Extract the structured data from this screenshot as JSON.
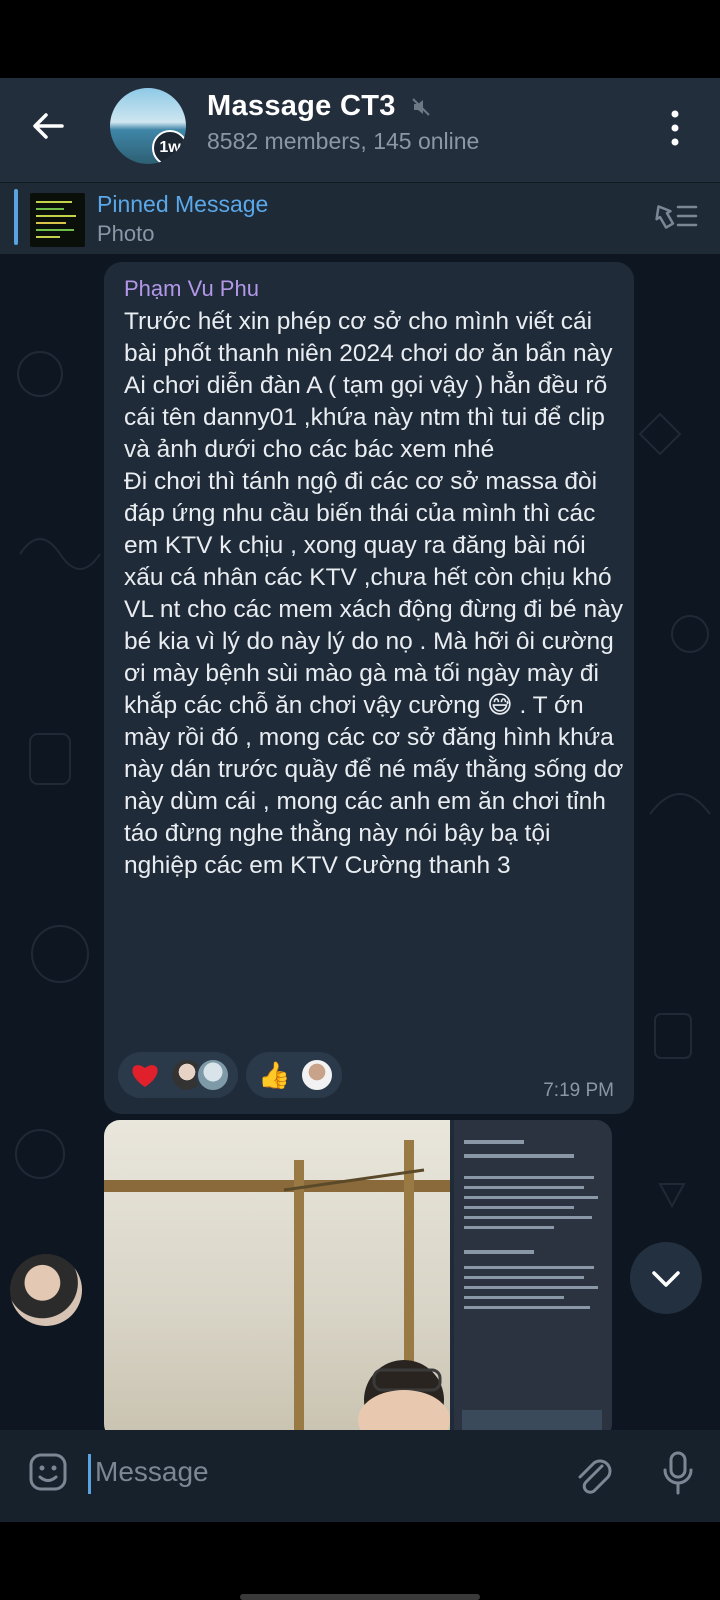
{
  "header": {
    "title": "Massage CT3",
    "subtitle": "8582 members, 145 online",
    "avatar_badge": "1w"
  },
  "pinned": {
    "title": "Pinned Message",
    "subtitle": "Photo"
  },
  "message": {
    "sender": "Phạm Vu Phu",
    "text": "Trước hết xin phép cơ sở cho mình viết cái bài phốt thanh niên 2024 chơi dơ ăn bẩn này\nAi chơi diễn đàn A ( tạm gọi vậy ) hẳn đều rõ cái tên danny01 ,khứa này ntm thì tui để clip và ảnh dưới cho các bác xem nhé\nĐi chơi thì tánh ngộ đi các cơ sở massa đòi đáp ứng nhu cầu biến thái của mình thì các em KTV k chịu , xong quay ra đăng bài nói xấu cá nhân các KTV ,chưa hết còn chịu khó VL nt cho các mem xách động đừng đi bé này bé kia vì lý do này lý do nọ . Mà hỡi ôi cường ơi mày bệnh sùi mào gà mà tối ngày mày đi khắp các chỗ ăn chơi vậy cường 😅 . T ớn mày rồi đó , mong các cơ sở đăng hình khứa này dán trước quầy để né mấy thằng sống dơ này dùm cái , mong các anh em ăn chơi tỉnh táo đừng nghe thằng này nói bậy bạ tội nghiệp các em KTV Cường thanh 3",
    "time": "7:19 PM",
    "reactions": [
      {
        "emoji": "❤",
        "icon": "heart-icon"
      },
      {
        "emoji": "👍",
        "icon": "thumbs-up-icon"
      }
    ]
  },
  "input": {
    "placeholder": "Message"
  },
  "colors": {
    "header_bg": "#232e3c",
    "chat_bg": "#0e1621",
    "bubble_bg": "#1f2b38",
    "accent": "#5aa3e0",
    "sender_name": "#b397e8"
  }
}
